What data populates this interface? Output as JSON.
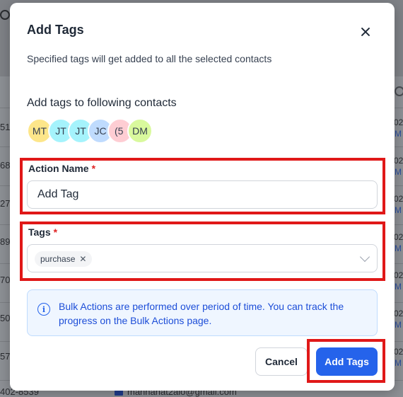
{
  "background": {
    "left_numbers": [
      "51",
      "68",
      "27",
      "89",
      "70",
      "50",
      "57"
    ],
    "right_numbers": [
      "02",
      "02",
      "02",
      "02",
      "02",
      "02",
      "02"
    ],
    "right_links": [
      "M",
      "M",
      "M",
      "M",
      "M",
      "M",
      "M"
    ],
    "bottom_phone": "402-8539",
    "bottom_email": "mannanat2alo@gmail.com"
  },
  "modal": {
    "title": "Add Tags",
    "subtitle": "Specified tags will get added to all the selected contacts",
    "contacts_label": "Add tags to following contacts",
    "avatars": [
      {
        "initials": "MT",
        "color": "#fde68a"
      },
      {
        "initials": "JT",
        "color": "#a5f3fc"
      },
      {
        "initials": "JT",
        "color": "#a5f3fc"
      },
      {
        "initials": "JC",
        "color": "#bfdbfe"
      },
      {
        "initials": "(5",
        "color": "#fecdd3"
      },
      {
        "initials": "DM",
        "color": "#d9f99d"
      }
    ],
    "action_name": {
      "label": "Action Name",
      "required_mark": "*",
      "value": "Add Tag"
    },
    "tags": {
      "label": "Tags",
      "required_mark": "*",
      "selected": [
        "purchase"
      ],
      "remove_glyph": "✕"
    },
    "info": {
      "icon": "info-icon",
      "text": "Bulk Actions are performed over period of time. You can track the progress on the Bulk Actions page."
    },
    "buttons": {
      "cancel": "Cancel",
      "submit": "Add Tags"
    },
    "highlight_color": "#e01818",
    "accent_color": "#2563eb"
  }
}
